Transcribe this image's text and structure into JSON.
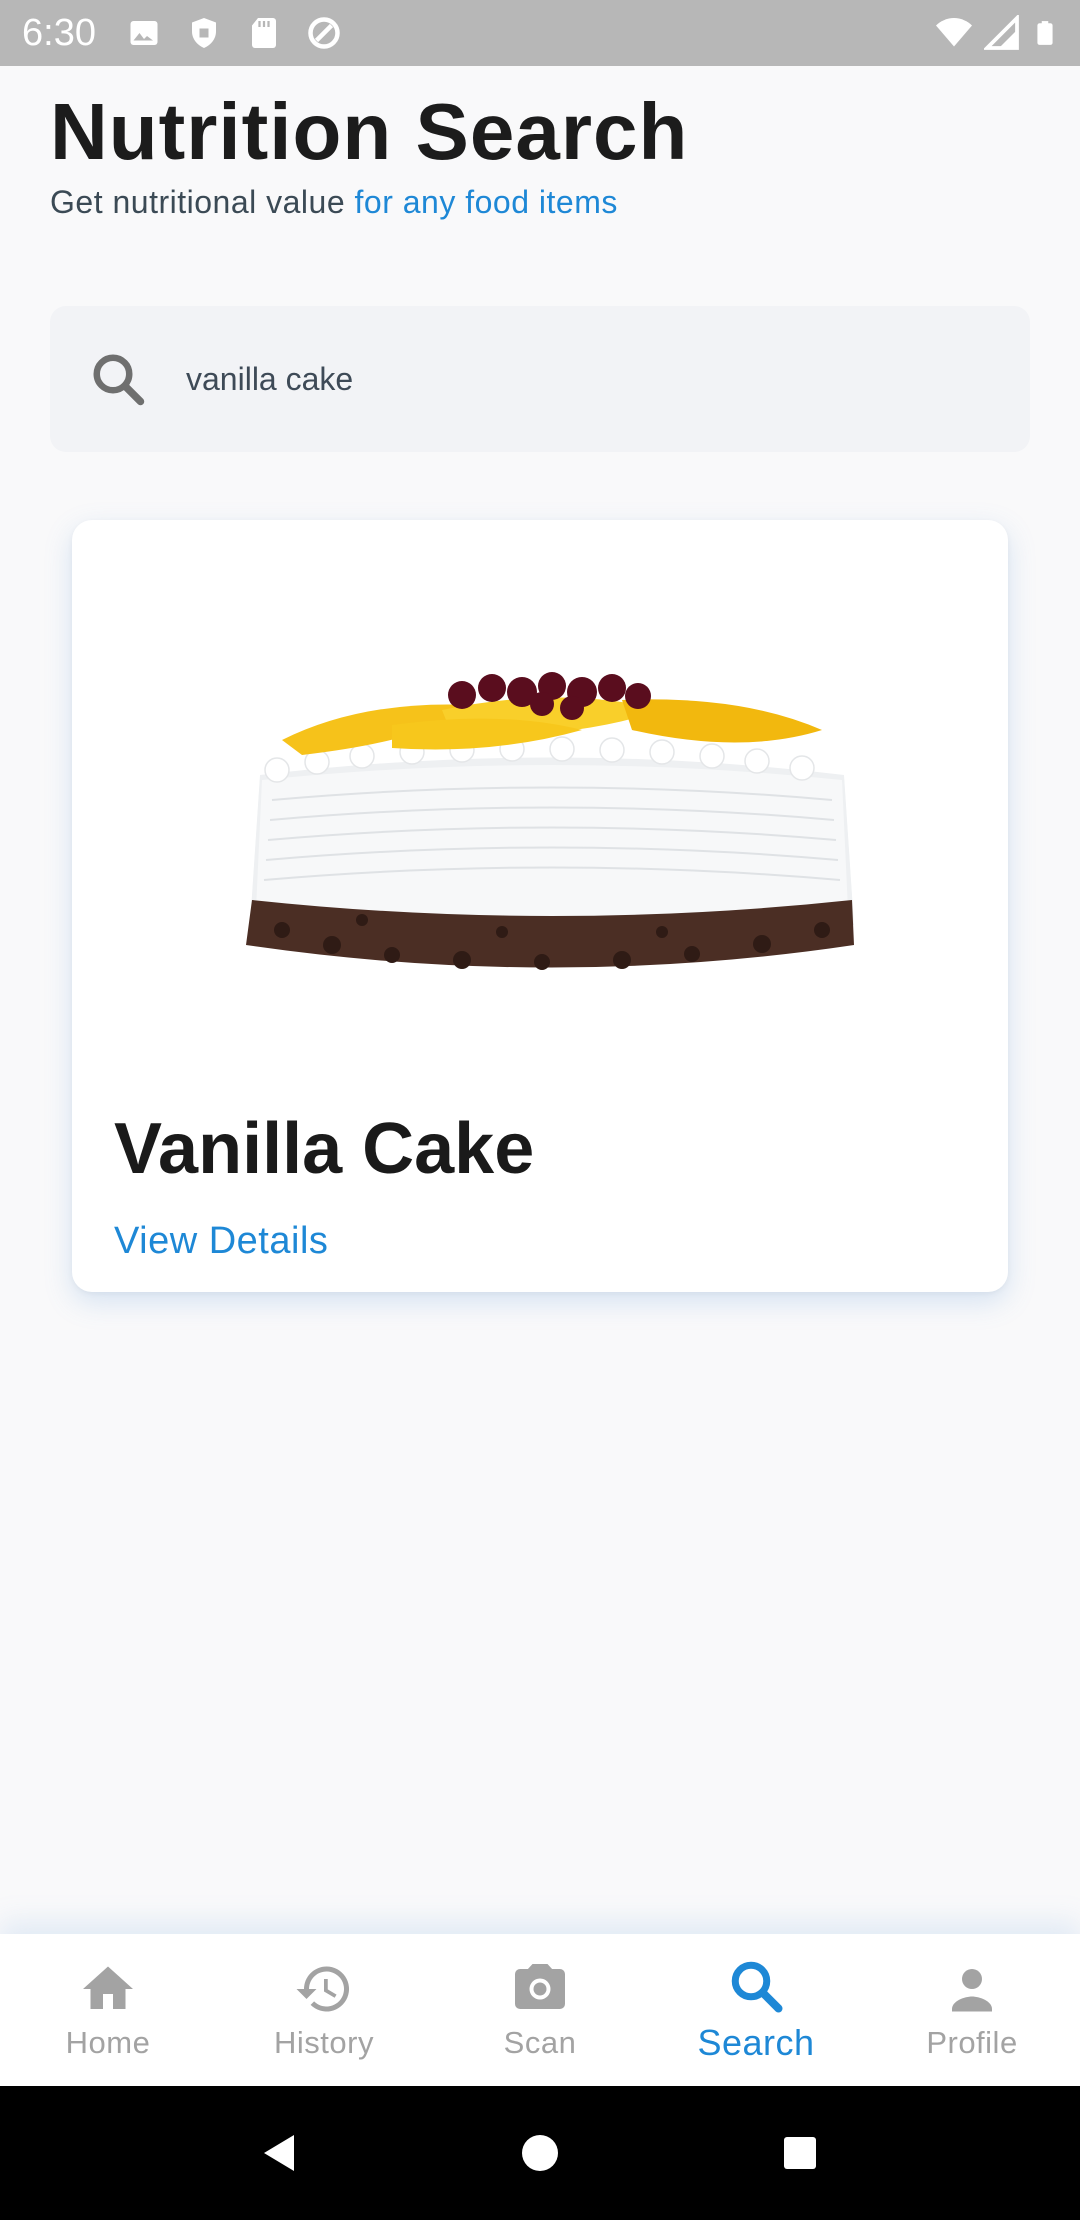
{
  "status_bar": {
    "time": "6:30",
    "left_icons": [
      "image-icon",
      "shield-icon",
      "sd-card-icon",
      "at-sign-icon"
    ],
    "right_icons": [
      "wifi-icon",
      "signal-icon",
      "battery-icon"
    ]
  },
  "header": {
    "title": "Nutrition Search",
    "subtitle_plain": "Get nutritional value ",
    "subtitle_accent": "for any food items"
  },
  "search": {
    "value": "vanilla cake",
    "icon": "search-icon"
  },
  "result": {
    "title": "Vanilla Cake",
    "link_label": "View Details",
    "image": "cake-image"
  },
  "bottom_nav": {
    "items": [
      {
        "label": "Home",
        "icon": "home-icon",
        "active": false
      },
      {
        "label": "History",
        "icon": "history-icon",
        "active": false
      },
      {
        "label": "Scan",
        "icon": "camera-icon",
        "active": false
      },
      {
        "label": "Search",
        "icon": "search-icon",
        "active": true
      },
      {
        "label": "Profile",
        "icon": "person-icon",
        "active": false
      }
    ]
  },
  "system_nav": [
    "back-icon",
    "home-circle-icon",
    "recents-icon"
  ],
  "colors": {
    "accent": "#1e88d6",
    "inactive": "#a3a3a3",
    "status_bar": "#b7b7b7"
  }
}
